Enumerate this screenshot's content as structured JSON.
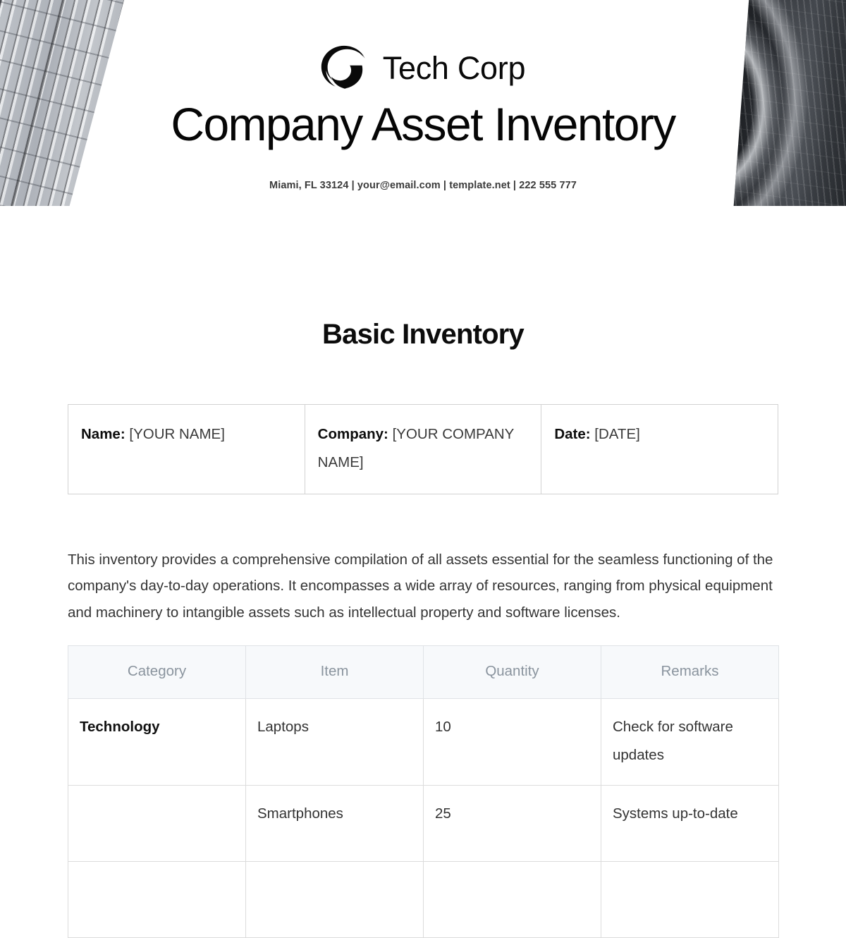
{
  "header": {
    "logo_icon": "ring-swirl-logo-icon",
    "brand_name": "Tech Corp",
    "document_title": "Company Asset Inventory",
    "contact_line": "Miami, FL 33124 | your@email.com | template.net | 222 555 777",
    "photo_left": "glass-building-facade-photo",
    "photo_right": "curved-tower-photo"
  },
  "section": {
    "title": "Basic Inventory"
  },
  "info": {
    "name_label": "Name:",
    "name_value": "[YOUR NAME]",
    "company_label": "Company:",
    "company_value": "[YOUR COMPANY NAME]",
    "date_label": "Date:",
    "date_value": "[DATE]"
  },
  "intro": {
    "paragraph": "This inventory provides a comprehensive compilation of all assets essential for the seamless functioning of the company's day-to-day operations. It encompasses a wide array of resources, ranging from physical equipment and machinery to intangible assets such as intellectual property and software licenses."
  },
  "asset_table": {
    "headers": [
      "Category",
      "Item",
      "Quantity",
      "Remarks"
    ],
    "rows": [
      {
        "category": "Technology",
        "item": "Laptops",
        "quantity": "10",
        "remarks": "Check for software updates"
      },
      {
        "category": "",
        "item": "Smartphones",
        "quantity": "25",
        "remarks": "Systems up-to-date"
      },
      {
        "category": "",
        "item": "",
        "quantity": "",
        "remarks": ""
      }
    ]
  },
  "colors": {
    "text_primary": "#111111",
    "text_body": "#333333",
    "header_cell_bg": "#f7f9fb",
    "header_cell_text": "#8a949e",
    "border": "#dcdcdc"
  }
}
